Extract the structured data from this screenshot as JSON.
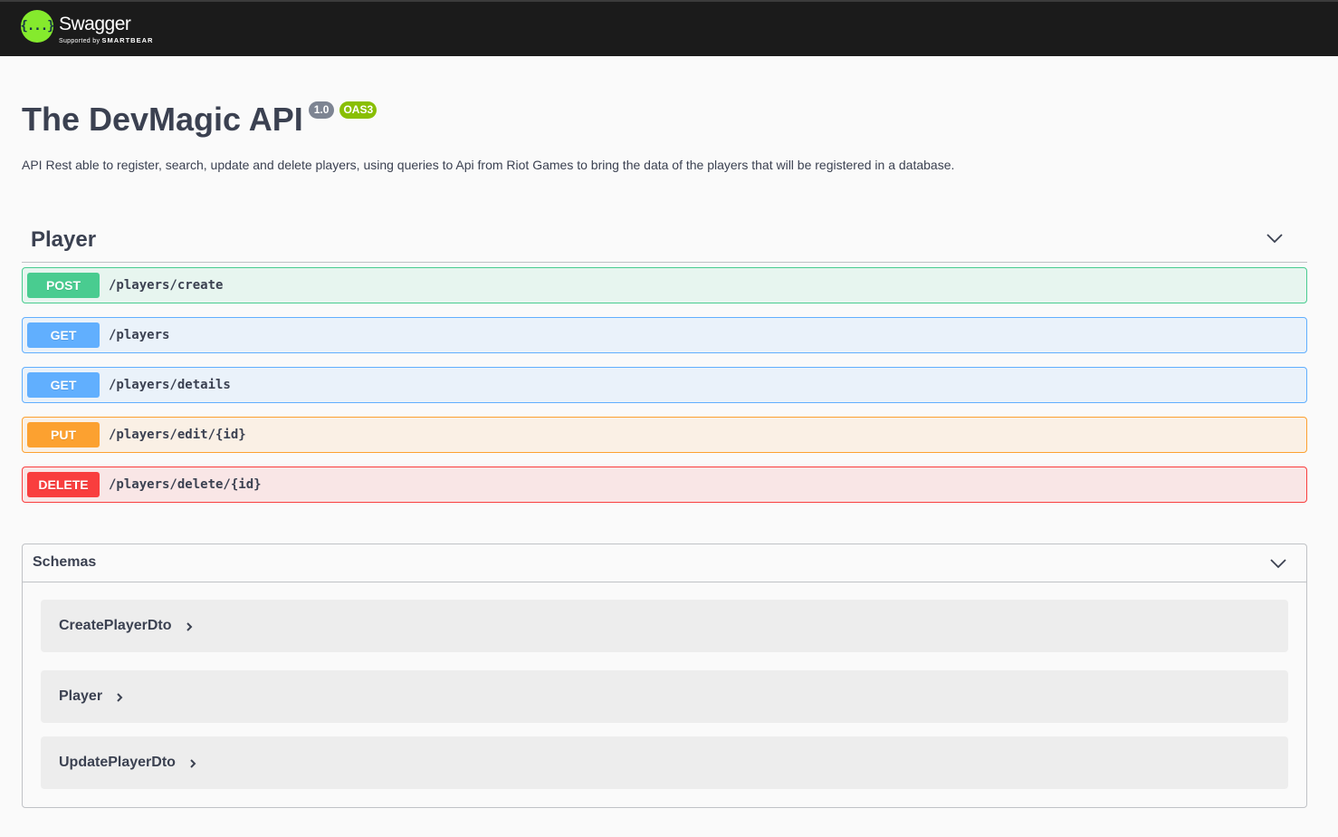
{
  "topbar": {
    "logo_glyph": "{...}",
    "logo_name": "Swagger",
    "logo_supported": "Supported by",
    "logo_company": "SMARTBEAR",
    "logo_color": "#85ea2d"
  },
  "info": {
    "title": "The DevMagic API",
    "version": "1.0",
    "oas_badge": "OAS3",
    "description": "API Rest able to register, search, update and delete players, using queries to Api from Riot Games to bring the data of the players that will be registered in a database."
  },
  "tag": {
    "name": "Player",
    "chevron_icon": "chevron-down-icon"
  },
  "operations": [
    {
      "method": "POST",
      "path": "/players/create",
      "color": "#49cc90"
    },
    {
      "method": "GET",
      "path": "/players",
      "color": "#61affe"
    },
    {
      "method": "GET",
      "path": "/players/details",
      "color": "#61affe"
    },
    {
      "method": "PUT",
      "path": "/players/edit/{id}",
      "color": "#fca130"
    },
    {
      "method": "DELETE",
      "path": "/players/delete/{id}",
      "color": "#f93e3e"
    }
  ],
  "schemas": {
    "title": "Schemas",
    "chevron_icon": "chevron-down-icon",
    "models": [
      {
        "name": "CreatePlayerDto",
        "icon": "chevron-right-icon"
      },
      {
        "name": "Player",
        "icon": "chevron-right-icon"
      },
      {
        "name": "UpdatePlayerDto",
        "icon": "chevron-right-icon"
      }
    ]
  }
}
